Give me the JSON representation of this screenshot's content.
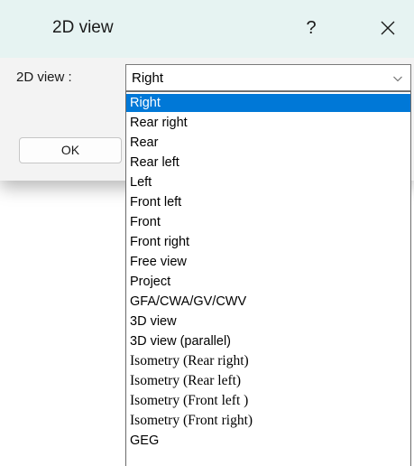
{
  "dialog": {
    "title": "2D view",
    "help_label": "?",
    "field_label": "2D view :",
    "selected_value": "Right",
    "ok_label": "OK"
  },
  "icons": {
    "close": "close-icon",
    "dropdown": "chevron-down-icon"
  },
  "colors": {
    "titlebar": "#e6f3f2",
    "selection": "#0078d7"
  },
  "dropdown": {
    "options": [
      "Right",
      "Rear right",
      "Rear",
      "Rear left",
      "Left",
      "Front left",
      "Front",
      "Front right",
      "Free view",
      "Project",
      "GFA/CWA/GV/CWV",
      "3D view",
      "3D view (parallel)",
      "Isometry (Rear right)",
      "Isometry (Rear left)",
      "Isometry (Front left )",
      "Isometry (Front right)",
      "GEG"
    ]
  }
}
